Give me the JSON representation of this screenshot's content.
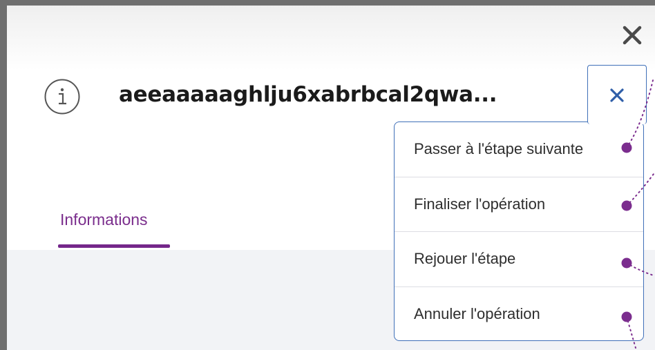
{
  "panel": {
    "close_icon": "close-icon",
    "info_icon": "info-icon",
    "title": "aeeaaaaaghlju6xabrbcal2qwa..."
  },
  "menu_toggle": {
    "icon": "close-icon",
    "color": "#3f6fb8"
  },
  "tabs": [
    {
      "label": "Informations",
      "active": true,
      "color": "#7a2d8c"
    }
  ],
  "menu": {
    "items": [
      {
        "label": "Passer à l'étape suivante"
      },
      {
        "label": "Finaliser l'opération"
      },
      {
        "label": "Rejouer l'étape"
      },
      {
        "label": "Annuler l'opération"
      }
    ]
  },
  "annotation_marker_color": "#7b2d8e"
}
